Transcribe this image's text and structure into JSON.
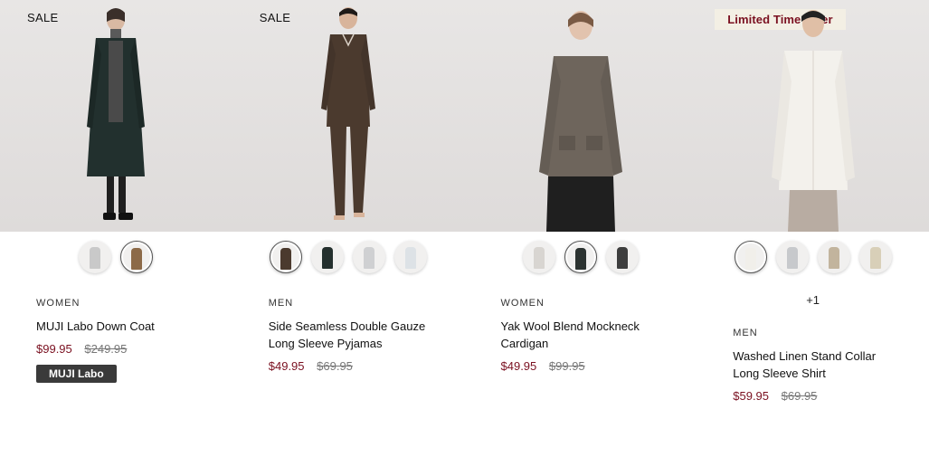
{
  "products": [
    {
      "badge": "SALE",
      "category": "WOMEN",
      "name": "MUJI Labo Down Coat",
      "sale_price": "$99.95",
      "original_price": "$249.95",
      "tag": "MUJI Labo",
      "colors": [
        "#c9c9c9",
        "#8c6a48"
      ]
    },
    {
      "badge": "SALE",
      "category": "MEN",
      "name": "Side Seamless Double Gauze Long Sleeve Pyjamas",
      "sale_price": "$49.95",
      "original_price": "$69.95",
      "colors": [
        "#4b3a2e",
        "#24302e",
        "#cfd0d2",
        "#dde2e6"
      ]
    },
    {
      "badge": "",
      "category": "WOMEN",
      "name": "Yak Wool Blend Mockneck Cardigan",
      "sale_price": "$49.95",
      "original_price": "$99.95",
      "colors": [
        "#d8d5d1",
        "#2c3331",
        "#3e3e3e"
      ]
    },
    {
      "badge": "Limited Time Offer",
      "category": "MEN",
      "name": "Washed Linen Stand Collar Long Sleeve Shirt",
      "sale_price": "$59.95",
      "original_price": "$69.95",
      "more_colors": "+1",
      "colors": [
        "#f1efea",
        "#c7c9cc",
        "#c2b49d",
        "#d8cfb8"
      ]
    }
  ]
}
